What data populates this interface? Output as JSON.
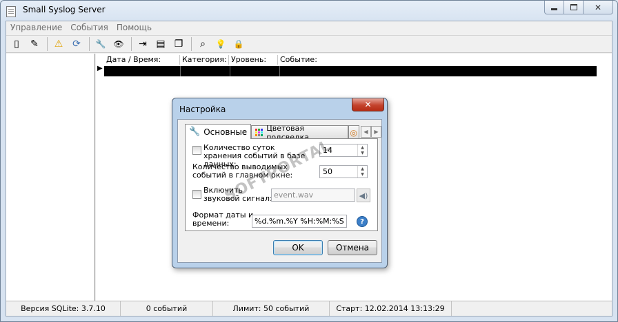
{
  "window": {
    "title": "Small Syslog Server"
  },
  "menu": {
    "items": [
      "Управление",
      "События",
      "Помощь"
    ]
  },
  "toolbar": {
    "buttons": [
      {
        "icon": "document-icon",
        "glyph": "▯"
      },
      {
        "icon": "edit-document-icon",
        "glyph": "✎"
      },
      {
        "icon": "warning-icon",
        "glyph": "⚠"
      },
      {
        "icon": "refresh-icon",
        "glyph": "⟳"
      },
      {
        "icon": "wrench-icon",
        "glyph": "🔧"
      },
      {
        "icon": "eye-icon",
        "glyph": "👁"
      },
      {
        "icon": "export-icon",
        "glyph": "⇥"
      },
      {
        "icon": "table-settings-icon",
        "glyph": "▤"
      },
      {
        "icon": "copy-icon",
        "glyph": "❐"
      },
      {
        "icon": "binoculars-icon",
        "glyph": "⌕"
      },
      {
        "icon": "lightbulb-icon",
        "glyph": "💡"
      },
      {
        "icon": "lock-icon",
        "glyph": "🔒"
      }
    ]
  },
  "log": {
    "columns": [
      "Дата / Время:",
      "Категория:",
      "Уровень:",
      "Событие:"
    ]
  },
  "status": {
    "sqlite": "Версия SQLite: 3.7.10",
    "count": "0 событий",
    "limit": "Лимит: 50 событий",
    "start": "Старт: 12.02.2014 13:13:29"
  },
  "dialog": {
    "title": "Настройка",
    "tabs": {
      "main": "Основные",
      "colors": "Цветовая подсведка"
    },
    "retention_label": "Количество суток хранения событий в базе данных:",
    "retention_value": "14",
    "display_label": "Количество выводимых событий в главном окне:",
    "display_value": "50",
    "sound_label": "Включить звуковой сигнал:",
    "sound_file": "event.wav",
    "format_label": "Формат даты и времени:",
    "format_value": "%d.%m.%Y %H:%M:%S",
    "ok": "OK",
    "cancel": "Отмена"
  },
  "watermark": "SOFTPORTAL",
  "colors": {
    "accent": "#3c7fb1",
    "close": "#c4432d",
    "log_row": "#000000"
  }
}
